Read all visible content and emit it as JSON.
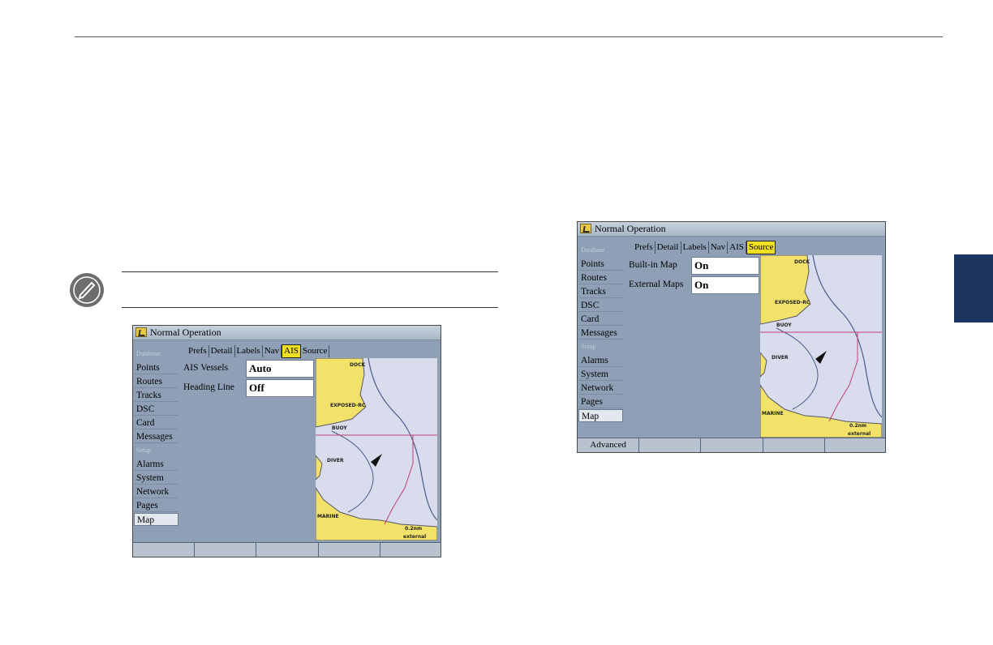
{
  "screen_a": {
    "title": "Normal Operation",
    "menu": [
      {
        "label": "Database",
        "header": true
      },
      {
        "label": "Points"
      },
      {
        "label": "Routes"
      },
      {
        "label": "Tracks"
      },
      {
        "label": "DSC"
      },
      {
        "label": "Card"
      },
      {
        "label": "Messages"
      },
      {
        "label": "Setup",
        "header": true
      },
      {
        "label": "Alarms"
      },
      {
        "label": "System"
      },
      {
        "label": "Network"
      },
      {
        "label": "Pages"
      },
      {
        "label": "Map",
        "selected": true
      }
    ],
    "tabs": [
      "Prefs",
      "Detail",
      "Labels",
      "Nav",
      "AIS",
      "Source"
    ],
    "active_tab": "AIS",
    "options": [
      {
        "label": "AIS Vessels",
        "value": "Auto"
      },
      {
        "label": "Heading Line",
        "value": "Off"
      }
    ],
    "softkeys": [
      "",
      "",
      "",
      "",
      ""
    ]
  },
  "screen_b": {
    "title": "Normal Operation",
    "menu": [
      {
        "label": "Database",
        "header": true
      },
      {
        "label": "Points"
      },
      {
        "label": "Routes"
      },
      {
        "label": "Tracks"
      },
      {
        "label": "DSC"
      },
      {
        "label": "Card"
      },
      {
        "label": "Messages"
      },
      {
        "label": "Setup",
        "header": true
      },
      {
        "label": "Alarms"
      },
      {
        "label": "System"
      },
      {
        "label": "Network"
      },
      {
        "label": "Pages"
      },
      {
        "label": "Map",
        "selected": true
      }
    ],
    "tabs": [
      "Prefs",
      "Detail",
      "Labels",
      "Nav",
      "AIS",
      "Source"
    ],
    "active_tab": "Source",
    "options": [
      {
        "label": "Built-in Map",
        "value": "On"
      },
      {
        "label": "External Maps",
        "value": "On"
      }
    ],
    "softkeys": [
      "Advanced",
      "",
      "",
      "",
      ""
    ]
  },
  "map_labels": {
    "dock": "DOCK",
    "exposed": "EXPOSED-RC",
    "buoy": "BUOY",
    "diver": "DIVER",
    "marine": "MARINE",
    "scale": "0.2nm",
    "source": "external"
  },
  "colors": {
    "land": "#f2e26a",
    "water": "#d8dcec",
    "screen_bg": "#8fa0b6",
    "active_tab": "#f0e022",
    "side_tab": "#1c3560"
  }
}
